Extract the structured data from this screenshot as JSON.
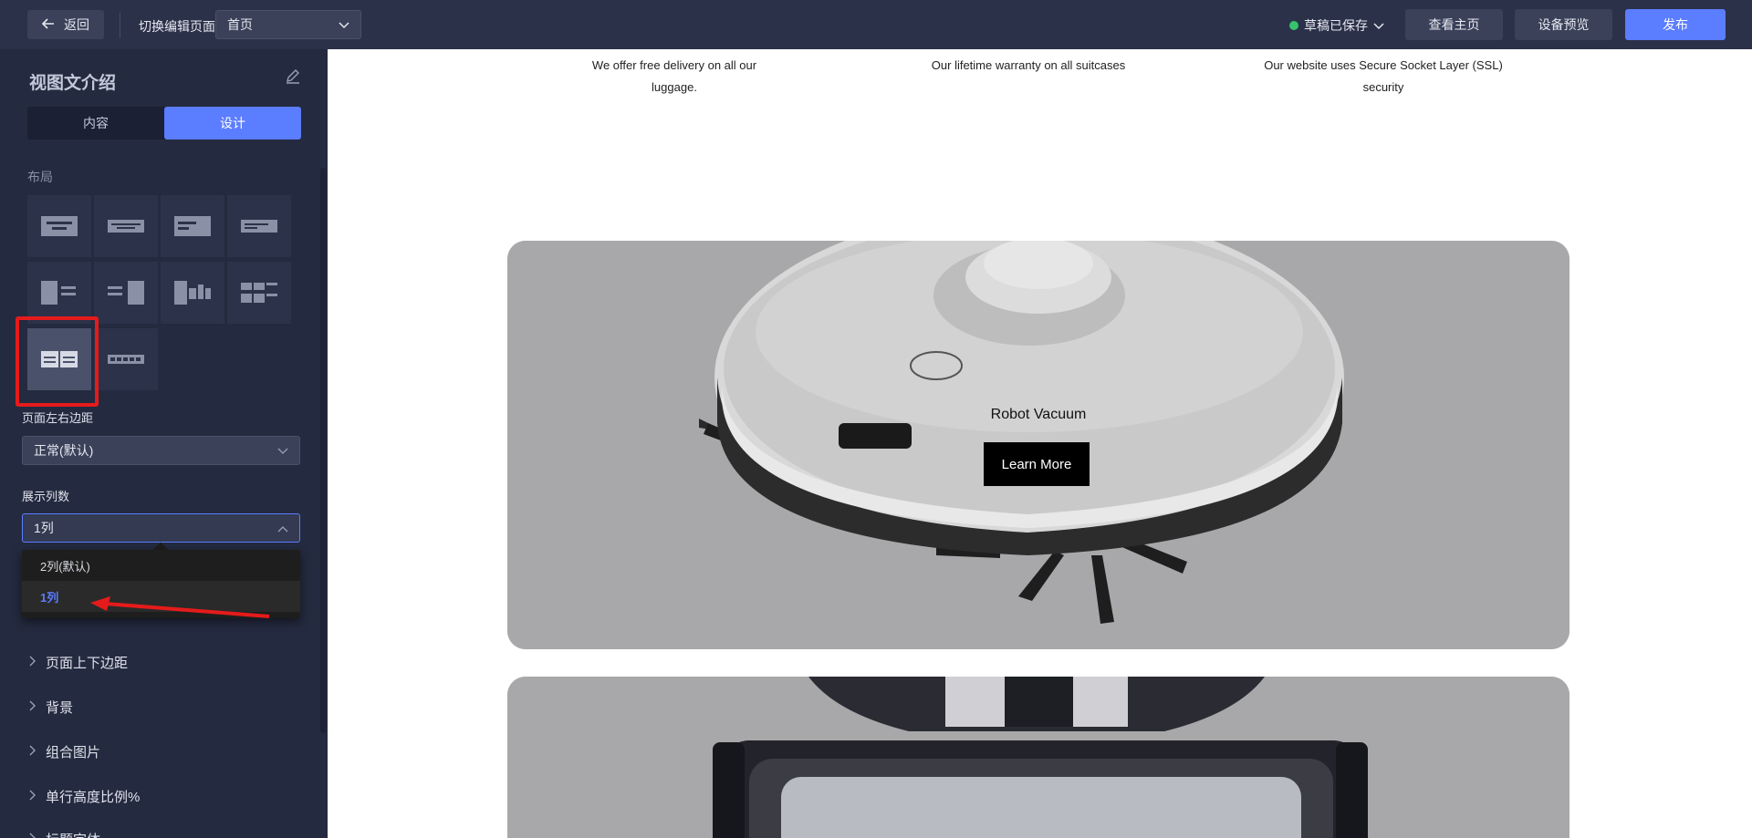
{
  "topbar": {
    "back_label": "返回",
    "switch_label": "切换编辑页面",
    "page_select_value": "首页",
    "draft_status": "草稿已保存",
    "view_home_label": "查看主页",
    "preview_label": "设备预览",
    "publish_label": "发布"
  },
  "sidebar": {
    "title": "视图文介绍",
    "tabs": [
      "内容",
      "设计"
    ],
    "active_tab": "设计",
    "layout_label": "布局",
    "margin_label": "页面左右边距",
    "margin_value": "正常(默认)",
    "columns_label": "展示列数",
    "columns_value": "1列",
    "columns_options": [
      "2列(默认)",
      "1列"
    ],
    "sections": [
      "页面上下边距",
      "背景",
      "组合图片",
      "单行高度比例%",
      "标题字体"
    ]
  },
  "canvas": {
    "features": [
      "We offer free delivery on all our luggage.",
      "Our lifetime warranty on all suitcases",
      "Our website uses Secure Socket Layer (SSL) security"
    ],
    "cards": [
      {
        "title": "Robot Vacuum",
        "button": "Learn More"
      },
      {
        "title": "",
        "button": ""
      }
    ]
  },
  "colors": {
    "accent": "#5b7dff",
    "highlight_red": "#e51b1b",
    "status_green": "#37c26d"
  }
}
